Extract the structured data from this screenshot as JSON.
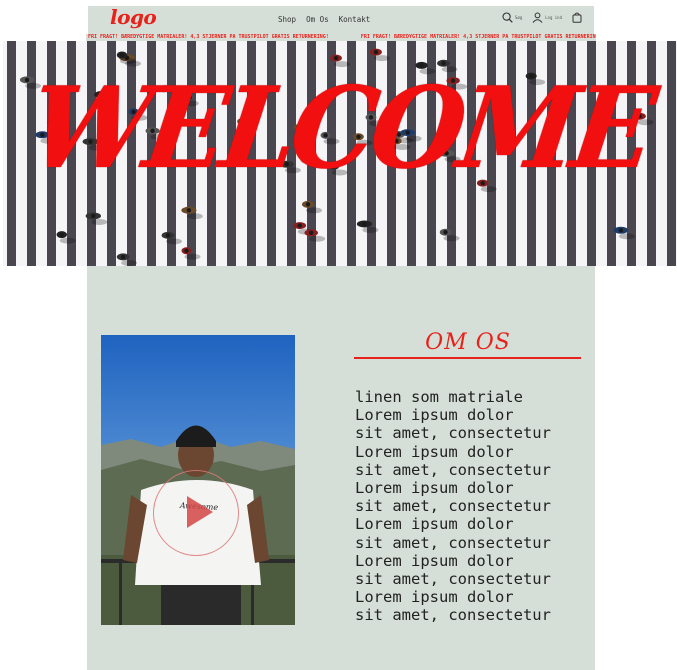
{
  "nav": {
    "logo": "logo",
    "links": [
      "Shop",
      "Om Os",
      "Kontakt"
    ],
    "search_label": "Søg",
    "login_label": "Log ind",
    "icons": [
      "search-icon",
      "user-icon",
      "cart-icon"
    ]
  },
  "marquee": {
    "text": "FRI FRAGT! BÆREDYGTIGE MATRIALER! 4,3 STJERNER PÅ TRUSTPILOT GRATIS RETURNERING!"
  },
  "hero": {
    "title": "WELCOME"
  },
  "about": {
    "title": "OM OS",
    "body": "linen som matriale\nLorem ipsum dolor\nsit amet, consectetur\nLorem ipsum dolor\nsit amet, consectetur\nLorem ipsum dolor\nsit amet, consectetur\nLorem ipsum dolor\nsit amet, consectetur\nLorem ipsum dolor\nsit amet, consectetur\nLorem ipsum dolor\nsit amet, consectetur",
    "shirt_text": "Awesome"
  },
  "colors": {
    "accent": "#e8211a",
    "panel": "#d6dfd7"
  }
}
